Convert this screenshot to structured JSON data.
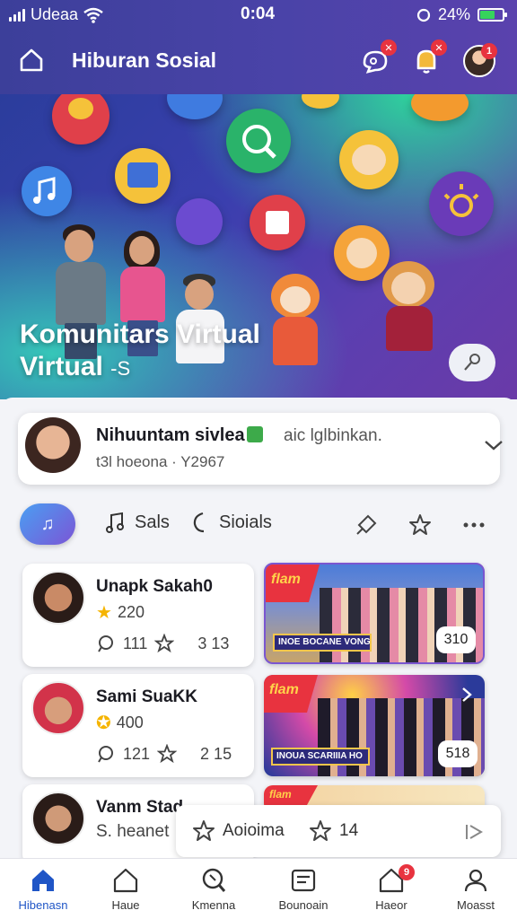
{
  "status_bar": {
    "carrier": "Udeaa",
    "time": "0:04",
    "battery": "24%"
  },
  "header": {
    "title": "Hiburan Sosial",
    "notifications": [
      {
        "icon": "chat-bubbles-icon",
        "badge": "✕"
      },
      {
        "icon": "bell-icon",
        "badge": "✕"
      },
      {
        "icon": "avatar",
        "badge": "1"
      }
    ]
  },
  "hero": {
    "title_line1": "Komunitars Virtual",
    "title_line2": "Virtual",
    "title_suffix": "-S"
  },
  "user_card": {
    "name": "Nihuuntam sivlea",
    "extra": "aic lglbinkan.",
    "subtitle": "t3l hoeona · Y2967"
  },
  "tabs": [
    {
      "label": "Sals",
      "icon": "music-note-icon"
    },
    {
      "label": "Sioials",
      "icon": "crescent-icon"
    }
  ],
  "posts": [
    {
      "name": "Unapk Sakah0",
      "score": "220",
      "comments": "111",
      "stars": "3 13",
      "media_logo": "flam",
      "media_banner": "INOE BOCANE VONGSS",
      "media_count": "310"
    },
    {
      "name": "Sami SuaKK",
      "score": "400",
      "comments": "121",
      "stars": "2 15",
      "media_logo": "flam",
      "media_banner": "INOUA SCARIIIA HO",
      "media_count": "518"
    },
    {
      "name": "Vanm Stad",
      "subtitle": "S. heanet",
      "media_logo": "flam"
    }
  ],
  "floating_card": {
    "left_label": "Aoioima",
    "star_count": "14"
  },
  "bottom_nav": [
    {
      "label": "Hibenasn",
      "icon": "home-icon",
      "active": true
    },
    {
      "label": "Haue",
      "icon": "house-outline-icon"
    },
    {
      "label": "Kmenna",
      "icon": "search-icon"
    },
    {
      "label": "Bounoain",
      "icon": "feed-icon"
    },
    {
      "label": "Haeor",
      "icon": "notification-house-icon",
      "badge": "9"
    },
    {
      "label": "Moasst",
      "icon": "profile-icon"
    }
  ],
  "colors": {
    "header": "#4a43a8",
    "accent_blue": "#1f55c6",
    "badge_red": "#e8333f",
    "star_yellow": "#f5b400"
  }
}
